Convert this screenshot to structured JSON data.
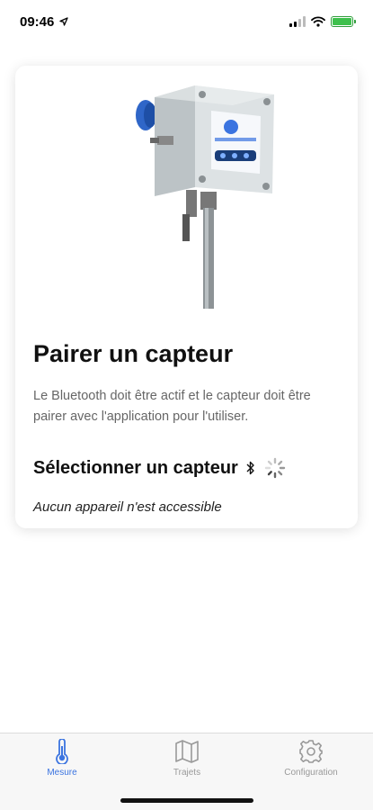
{
  "status": {
    "time": "09:46"
  },
  "card": {
    "title": "Pairer un capteur",
    "description": "Le Bluetooth doit être actif et le capteur doit être pairer avec l'application pour l'utiliser.",
    "select_title": "Sélectionner un capteur",
    "empty_message": "Aucun appareil n'est accessible"
  },
  "tabs": [
    {
      "label": "Mesure",
      "icon": "thermometer-icon",
      "active": true
    },
    {
      "label": "Trajets",
      "icon": "map-icon",
      "active": false
    },
    {
      "label": "Configuration",
      "icon": "gear-icon",
      "active": false
    }
  ],
  "colors": {
    "accent": "#3b74e0",
    "inactive": "#999999",
    "battery": "#3ec04c"
  }
}
